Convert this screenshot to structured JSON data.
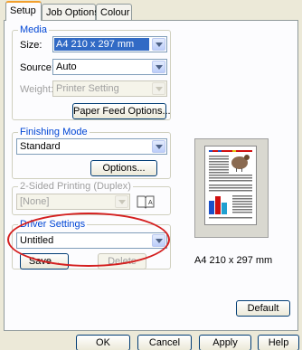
{
  "tabs": [
    {
      "label": "Setup"
    },
    {
      "label": "Job Options"
    },
    {
      "label": "Colour"
    }
  ],
  "media": {
    "group_label": "Media",
    "size_label": "Size:",
    "size_value": "A4 210 x 297 mm",
    "source_label": "Source:",
    "source_value": "Auto",
    "weight_label": "Weight:",
    "weight_value": "Printer Setting",
    "paper_feed_button": "Paper Feed Options..."
  },
  "finishing": {
    "group_label": "Finishing Mode",
    "value": "Standard",
    "options_button": "Options..."
  },
  "duplex": {
    "group_label": "2-Sided Printing (Duplex)",
    "value": "[None]"
  },
  "driver_settings": {
    "group_label": "Driver Settings",
    "value": "Untitled",
    "save_button": "Save...",
    "delete_button": "Delete"
  },
  "preview": {
    "caption": "A4 210 x 297 mm"
  },
  "default_button": "Default",
  "dialog_buttons": {
    "ok": "OK",
    "cancel": "Cancel",
    "apply": "Apply",
    "help": "Help"
  },
  "colors": {
    "group_label": "#0046d5",
    "highlight_selection": "#316ac5",
    "annotation_circle": "#d42020"
  }
}
